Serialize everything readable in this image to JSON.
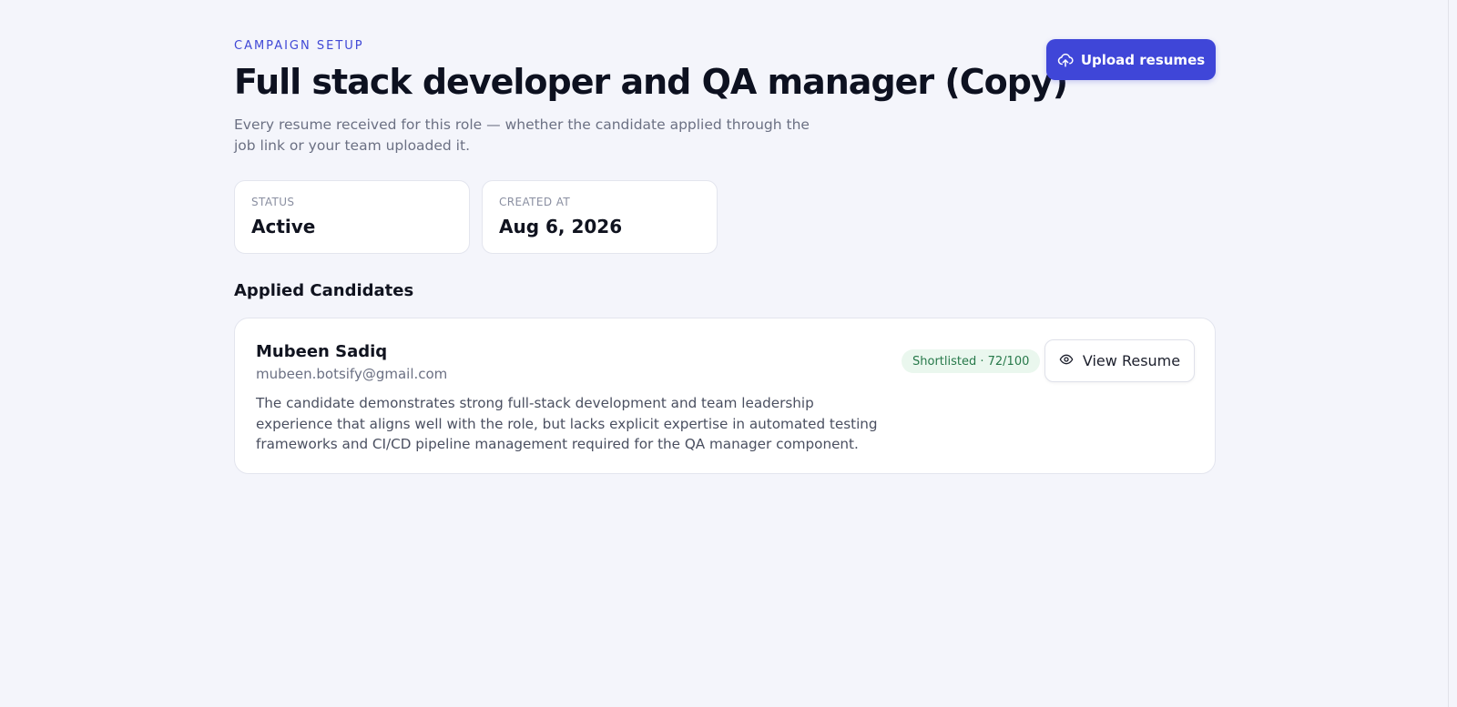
{
  "header": {
    "eyebrow": "CAMPAIGN SETUP",
    "title": "Full stack developer and QA manager (Copy)",
    "subtitle": "Every resume received for this role — whether the candidate applied through the job link or your team uploaded it.",
    "upload_label": "Upload resumes",
    "upload_icon": "cloud-upload-icon"
  },
  "stats": [
    {
      "label": "STATUS",
      "value": "Active"
    },
    {
      "label": "CREATED AT",
      "value": "Aug 6, 2026"
    }
  ],
  "candidates_section": {
    "title": "Applied Candidates",
    "items": [
      {
        "name": "Mubeen Sadiq",
        "email": "mubeen.botsify@gmail.com",
        "summary": "The candidate demonstrates strong full-stack development and team leadership experience that aligns well with the role, but lacks explicit expertise in automated testing frameworks and CI/CD pipeline management required for the QA manager component.",
        "badge": "Shortlisted · 72/100",
        "view_label": "View Resume",
        "view_icon": "eye-icon"
      }
    ]
  },
  "colors": {
    "accent": "#3f46d8",
    "background": "#f4f5fb",
    "badge_bg": "#eaf7ee",
    "badge_text": "#27794a"
  }
}
